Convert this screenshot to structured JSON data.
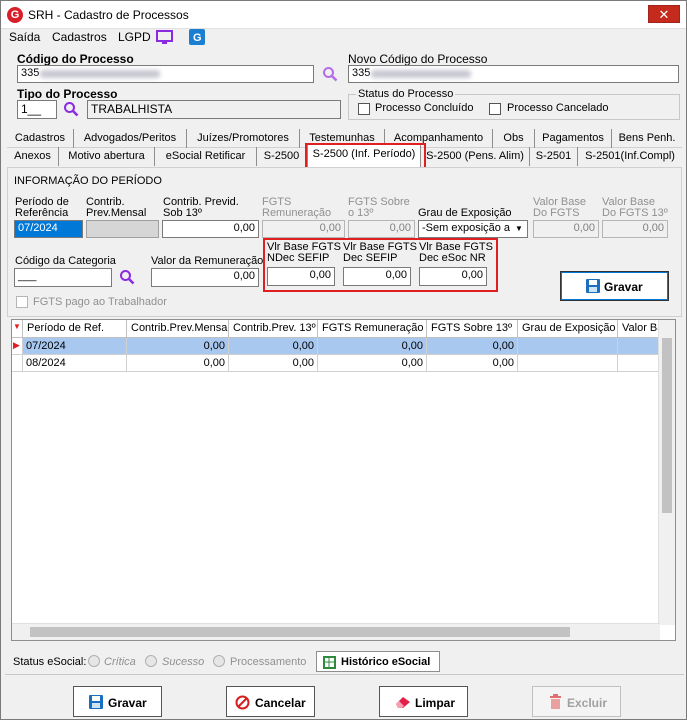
{
  "window": {
    "title": "SRH - Cadastro de Processos",
    "close_glyph": "✕"
  },
  "menu": {
    "items": [
      "Saída",
      "Cadastros",
      "LGPD"
    ]
  },
  "form": {
    "codigo_label": "Código do Processo",
    "codigo_value": "335",
    "novo_codigo_label": "Novo Código do Processo",
    "novo_codigo_value": "335",
    "tipo_label": "Tipo do Processo",
    "tipo_code": "1__",
    "tipo_value": "TRABALHISTA",
    "status_group": "Status do Processo",
    "concluido_label": "Processo Concluído",
    "cancelado_label": "Processo Cancelado"
  },
  "tabs_row1": [
    "Cadastros",
    "Advogados/Peritos",
    "Juízes/Promotores",
    "Testemunhas",
    "Acompanhamento",
    "Obs",
    "Pagamentos",
    "Bens Penh."
  ],
  "tabs_row2": [
    "Anexos",
    "Motivo abertura",
    "eSocial Retificar",
    "S-2500",
    "S-2500 (Inf. Período)",
    "S-2500 (Pens. Alim)",
    "S-2501",
    "S-2501(Inf.Compl)"
  ],
  "periodo": {
    "section_title": "INFORMAÇÃO DO PERÍODO",
    "periodo_ref_label1": "Período de",
    "periodo_ref_label2": "Referência",
    "periodo_ref_value": "07/2024",
    "contrib_mensal_label1": "Contrib.",
    "contrib_mensal_label2": "Prev.Mensal",
    "contrib_13_label1": "Contrib. Previd.",
    "contrib_13_label2": "Sob 13º",
    "contrib_13_value": "0,00",
    "fgts_rem_label1": "FGTS",
    "fgts_rem_label2": "Remuneração",
    "fgts_rem_value": "0,00",
    "fgts_13_label1": "FGTS Sobre",
    "fgts_13_label2": "o 13º",
    "fgts_13_value": "0,00",
    "grau_label": "Grau de Exposição",
    "grau_value": "-Sem exposição a",
    "vb_fgts_label1": "Valor Base",
    "vb_fgts_label2": "Do FGTS",
    "vb_fgts_value": "0,00",
    "vb_fgts13_label1": "Valor Base",
    "vb_fgts13_label2": "Do FGTS 13º",
    "vb_fgts13_value": "0,00",
    "cat_label": "Código da Categoria",
    "cat_value": "___",
    "valor_rem_label": "Valor da Remuneração",
    "valor_rem_value": "0,00",
    "vlr_ndec_label1": "Vlr Base FGTS",
    "vlr_ndec_label2": "NDec SEFIP",
    "vlr_ndec_value": "0,00",
    "vlr_dec_label1": "Vlr Base FGTS",
    "vlr_dec_label2": "Dec SEFIP",
    "vlr_dec_value": "0,00",
    "vlr_esoc_label1": "Vlr Base FGTS",
    "vlr_esoc_label2": "Dec eSoc NR",
    "vlr_esoc_value": "0,00",
    "gravar_label": "Gravar",
    "fgts_pago_label": "FGTS pago ao Trabalhador"
  },
  "grid": {
    "columns": [
      "Período de Ref.",
      "Contrib.Prev.Mensal",
      "Contrib.Prev. 13º",
      "FGTS Remuneração",
      "FGTS Sobre 13º",
      "Grau de Exposição",
      "Valor Base"
    ],
    "rows": [
      [
        "07/2024",
        "0,00",
        "0,00",
        "0,00",
        "0,00",
        "",
        ""
      ],
      [
        "08/2024",
        "0,00",
        "0,00",
        "0,00",
        "0,00",
        "",
        ""
      ]
    ]
  },
  "status": {
    "label": "Status eSocial:",
    "critica": "Crítica",
    "sucesso": "Sucesso",
    "processamento": "Processamento",
    "historico": "Histórico eSocial"
  },
  "buttons": {
    "gravar": "Gravar",
    "cancelar": "Cancelar",
    "limpar": "Limpar",
    "excluir": "Excluir"
  },
  "colors": {
    "accent": "#0078d7",
    "highlight": "#e02020",
    "selected_row": "#a8c8f0"
  }
}
